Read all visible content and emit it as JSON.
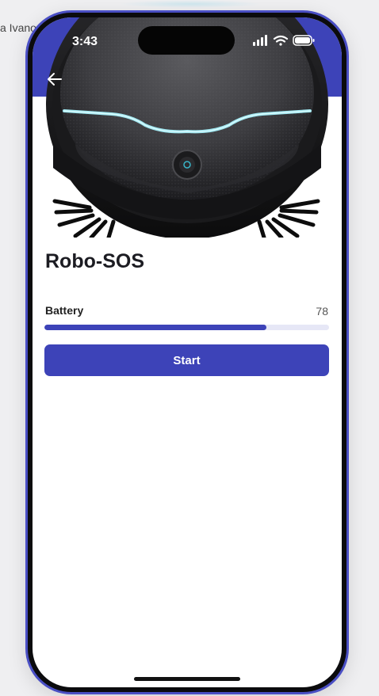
{
  "background": {
    "partial_text": "a Ivano"
  },
  "status_bar": {
    "time": "3:43",
    "icons": [
      "cellular-signal-icon",
      "wifi-icon",
      "battery-icon"
    ]
  },
  "header": {
    "back_icon": "arrow-left-icon"
  },
  "device": {
    "image_icon": "robot-vacuum-image",
    "name": "Robo-SOS",
    "battery_label": "Battery",
    "battery_value": "78",
    "battery_fraction": 0.78
  },
  "actions": {
    "start_label": "Start"
  },
  "colors": {
    "primary": "#3d43b8",
    "track": "#e6e7f6",
    "frame": "#4a4fc4"
  }
}
